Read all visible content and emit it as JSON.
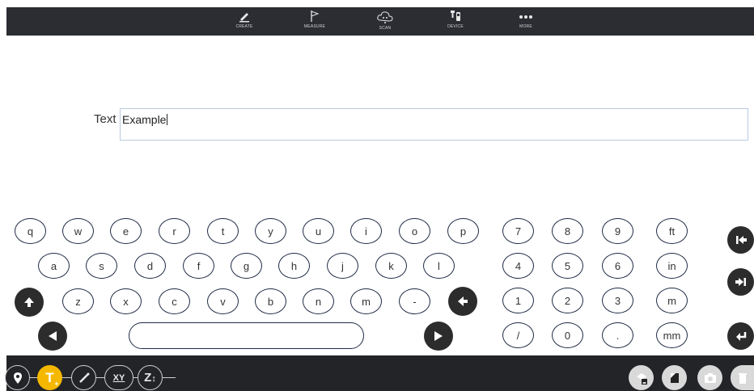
{
  "toolbar": {
    "items": [
      {
        "label": "CREATE",
        "icon": "pencil-icon"
      },
      {
        "label": "MEASURE",
        "icon": "flag-icon"
      },
      {
        "label": "SCAN",
        "icon": "cloud-icon"
      },
      {
        "label": "DEVICE",
        "icon": "device-icon"
      },
      {
        "label": "MORE",
        "icon": "more-icon"
      }
    ]
  },
  "field": {
    "label": "Text",
    "value": "Example"
  },
  "keyboard": {
    "row1": [
      "q",
      "w",
      "e",
      "r",
      "t",
      "y",
      "u",
      "i",
      "o",
      "p"
    ],
    "row2": [
      "a",
      "s",
      "d",
      "f",
      "g",
      "h",
      "j",
      "k",
      "l"
    ],
    "row3": [
      "z",
      "x",
      "c",
      "v",
      "b",
      "n",
      "m",
      "-"
    ],
    "numpad": [
      [
        "7",
        "8",
        "9",
        "ft"
      ],
      [
        "4",
        "5",
        "6",
        "in"
      ],
      [
        "1",
        "2",
        "3",
        "m"
      ],
      [
        "/",
        "0",
        ".",
        "mm"
      ]
    ],
    "shift_icon": "arrow-up-icon",
    "backspace_icon": "arrow-left-icon",
    "left_icon": "triangle-left-icon",
    "right_icon": "triangle-right-icon",
    "home_icon": "skip-start-icon",
    "end_icon": "skip-end-icon",
    "enter_icon": "enter-icon"
  },
  "bottombar": {
    "left_tools": [
      "location-pin-icon",
      "text-add-icon",
      "line-measure-icon",
      "xy-coordinate-icon",
      "z-elevation-icon"
    ],
    "xy_label": "XY",
    "z_label": "Z",
    "text_tool_label": "T",
    "right_tools": [
      "save-layer-icon",
      "note-icon",
      "camera-icon",
      "delete-icon"
    ]
  },
  "colors": {
    "topbar": "#2b2d33",
    "bottombar": "#222428",
    "accent": "#f5b800",
    "key_border": "#1f2b44"
  }
}
